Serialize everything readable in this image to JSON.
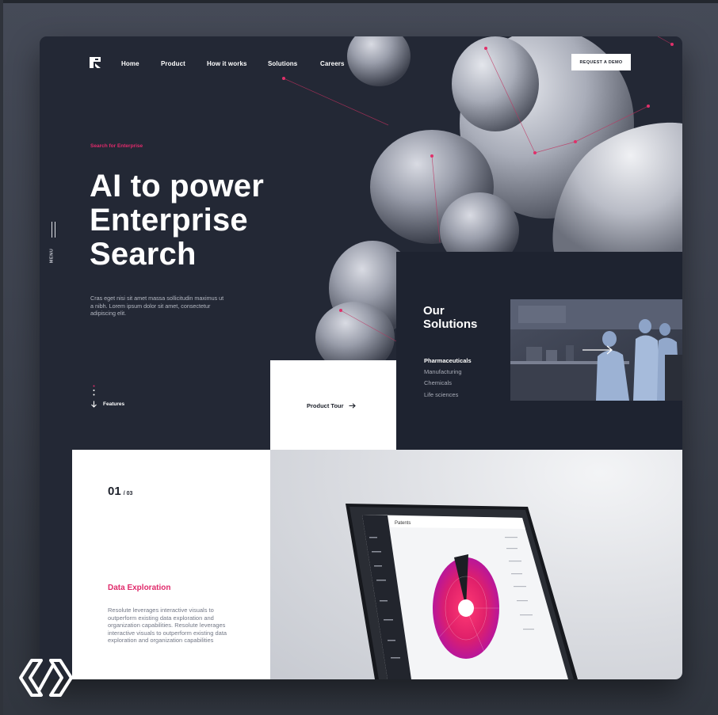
{
  "brand": {
    "logo_icon": "resolute-logo-icon"
  },
  "nav": {
    "items": [
      "Home",
      "Product",
      "How it works",
      "Solutions",
      "Careers"
    ],
    "cta_label": "REQUEST A DEMO"
  },
  "side_menu": {
    "label": "MENU"
  },
  "hero": {
    "eyebrow": "Search for Enterprise",
    "headline_lines": [
      "AI to power",
      "Enterprise",
      "Search"
    ],
    "lead": "Cras eget nisi sit amet massa sollicitudin maximus ut a nibh. Lorem ipsum dolor sit amet, consectetur adipiscing elit.",
    "features_label": "Features",
    "product_tour_label": "Product Tour"
  },
  "solutions": {
    "title_lines": [
      "Our",
      "Solutions"
    ],
    "items": [
      "Pharmaceuticals",
      "Manufacturing",
      "Chemicals",
      "Life sciences"
    ],
    "active_index": 0
  },
  "feature_slide": {
    "current": "01",
    "total": "/ 03",
    "title": "Data Exploration",
    "description": "Resolute leverages interactive visuals to outperform existing data exploration and organization capabilities. Resolute leverages interactive visuals to outperform existing data exploration and organization capabilities",
    "laptop_screen_title": "Patents"
  },
  "colors": {
    "accent": "#e02a6b",
    "panel_dark": "#232835",
    "panel_darker": "#1e2330",
    "page_bg": "#454a57"
  }
}
